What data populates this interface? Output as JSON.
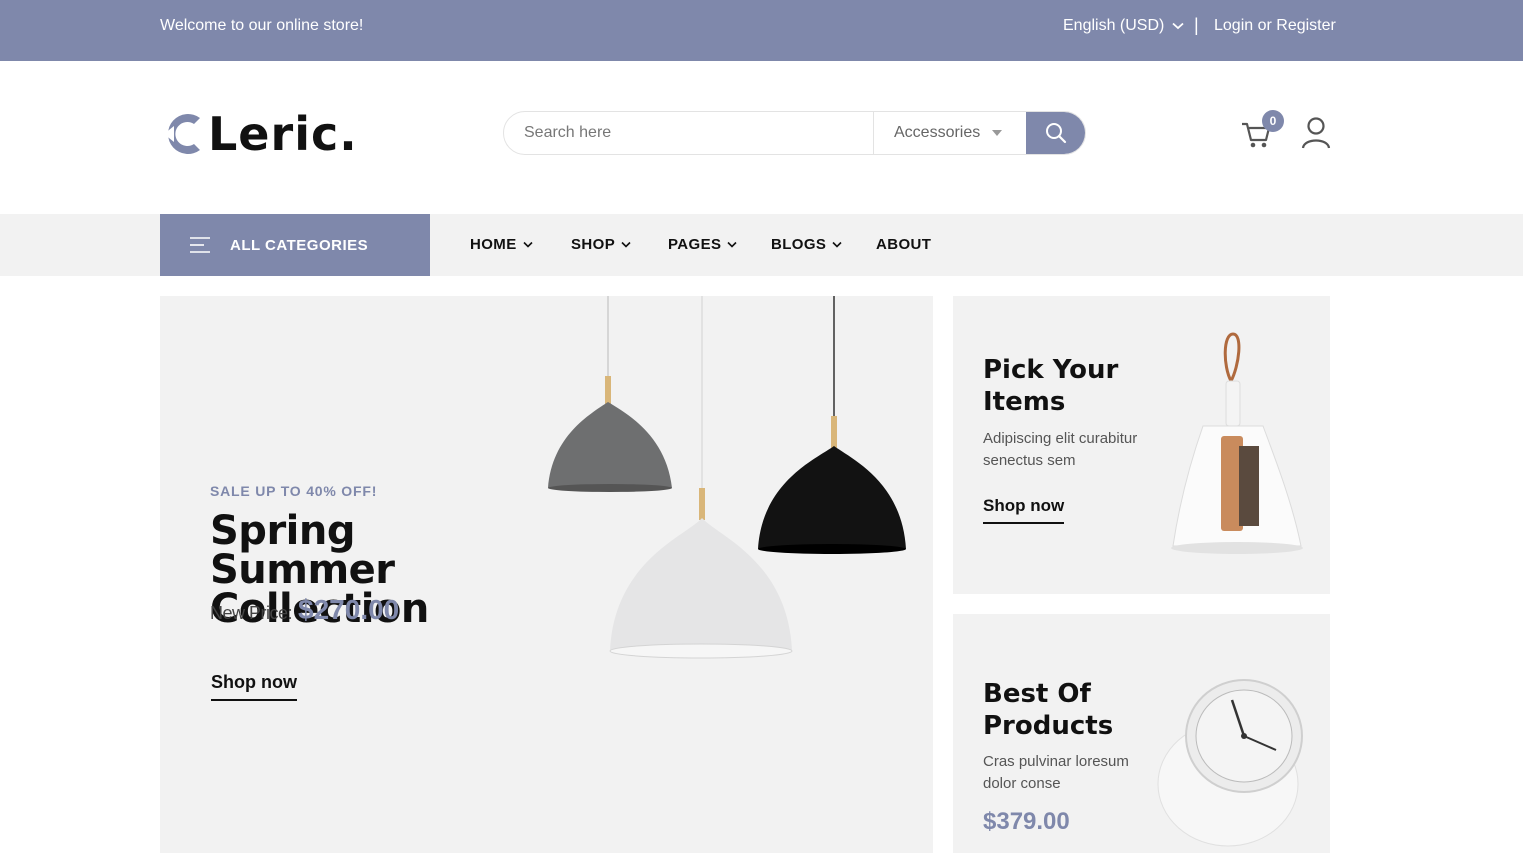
{
  "topbar": {
    "welcome": "Welcome to our online store!",
    "language": "English (USD)",
    "separator": "|",
    "login": "Login or Register"
  },
  "header": {
    "logo": "Leric.",
    "search_placeholder": "Search here",
    "search_category": "Accessories",
    "cart_count": "0"
  },
  "nav": {
    "all_categories": "ALL CATEGORIES",
    "items": [
      {
        "label": "HOME",
        "dropdown": true
      },
      {
        "label": "SHOP",
        "dropdown": true
      },
      {
        "label": "PAGES",
        "dropdown": true
      },
      {
        "label": "BLOGS",
        "dropdown": true
      },
      {
        "label": "ABOUT",
        "dropdown": false
      }
    ]
  },
  "hero": {
    "sale": "SALE UP TO 40% OFF!",
    "title": "Spring Summer Collection",
    "price_label": "New Price:",
    "price": "$270.00",
    "cta": "Shop now"
  },
  "banners": [
    {
      "title": "Pick Your Items",
      "desc": "Adipiscing elit curabitur senectus sem",
      "cta": "Shop now"
    },
    {
      "title": "Best Of Products",
      "desc": "Cras pulvinar loresum dolor conse",
      "price": "$379.00"
    }
  ],
  "colors": {
    "accent": "#7f88ab",
    "panel": "#f2f2f2",
    "text": "#111111"
  }
}
